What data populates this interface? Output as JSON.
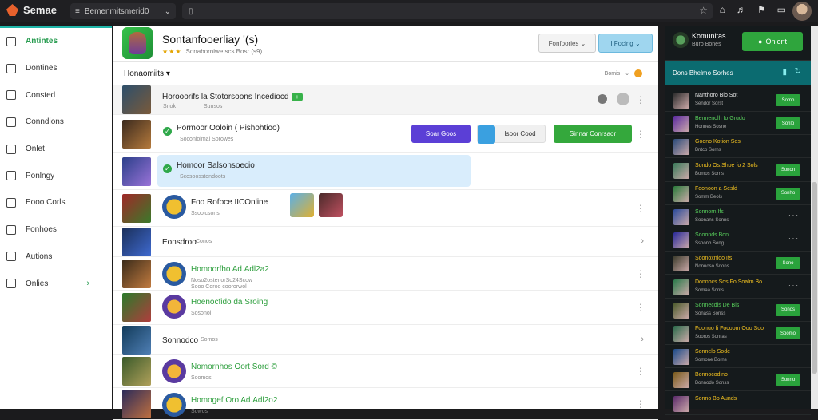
{
  "topbar": {
    "brand": "Semae",
    "address": "Bemenmitsmerid0",
    "url_icon": "≡",
    "star": "☆",
    "icons": [
      "house-icon",
      "bell-icon",
      "notify-icon",
      "window-icon",
      "tab-icon"
    ]
  },
  "sidebar": {
    "items": [
      {
        "label": "Antintes",
        "active": true
      },
      {
        "label": "Dontines"
      },
      {
        "label": "Consted"
      },
      {
        "label": "Conndions"
      },
      {
        "label": "Onlet"
      },
      {
        "label": "Ponlngy"
      },
      {
        "label": "Eooo Corls"
      },
      {
        "label": "Fonhoes"
      },
      {
        "label": "Autions"
      },
      {
        "label": "Onlies"
      }
    ]
  },
  "header": {
    "title": "Sontanfooerliay '(s)",
    "rating_text": "Sonaborniwe scs Bosr (s9)",
    "select": "Fonfoories",
    "button": "I Focing"
  },
  "sort": {
    "label": "Honaomiits",
    "right_label": "Bomis"
  },
  "rows": [
    {
      "title": "Horooorifs la Stotorsoons Incediocd",
      "badge": "+",
      "sub1": "Snok",
      "sub2": "Sunsos"
    },
    {
      "title": "Pormoor Ooloin ( Pishohtioo)",
      "sub": "Soconlolmal Sorowes",
      "btn1": "Soar Goos",
      "btn2": "Isoor Cood",
      "btn3": "Sinnar Conrsaor"
    },
    {
      "title": "Homoor Salsohsoecio",
      "sub": "Scosoosstondoots"
    },
    {
      "title": "Foo Rofoce IICOnline",
      "sub": "Ssooicsons"
    },
    {
      "title": "Eonsdroo",
      "sub": "Conos"
    },
    {
      "title": "Homoorfho Ad.Adl2a2",
      "sub": "Noso2ostenorSo24Scow",
      "sub2": "Sooo Coroo coororwol"
    },
    {
      "title": "Hoenocfido da Sroing",
      "sub": "Sosonoi"
    },
    {
      "title": "Sonnodco",
      "sub": "Somos"
    },
    {
      "title": "Nomornhos Oort Sord ©",
      "sub": "Soomos"
    },
    {
      "title": "Homogef Oro Ad.Adl2o2",
      "sub": "Sowos"
    }
  ],
  "right": {
    "title": "Komunitas",
    "subtitle": "Buro Bones",
    "online_button": "Onlent",
    "tab": "Dons Bhelmo Sorhes",
    "items": [
      {
        "name": "Nanthoro Bio Sot",
        "sub": "Sendor Sorst",
        "btn": "Somo",
        "style": ""
      },
      {
        "name": "Bennenolh Io Grudo",
        "sub": "Honnes Sosne",
        "btn": "Sonlo",
        "style": "g"
      },
      {
        "name": "Goono Kotion Sos",
        "sub": "Bntco Sorns",
        "btn": "",
        "style": "y"
      },
      {
        "name": "Sondo Os.Shoe fo 2 Sols",
        "sub": "Bomos Sorns",
        "btn": "Sonon",
        "style": "y"
      },
      {
        "name": "Foonoon a Sesld",
        "sub": "Somm Beols",
        "btn": "Sonho",
        "style": "y"
      },
      {
        "name": "Sonnorn Ifs",
        "sub": "Soonans Sonns",
        "btn": "",
        "style": "g"
      },
      {
        "name": "Sooonds Bon",
        "sub": "Ssoonb Song",
        "btn": "",
        "style": "g"
      },
      {
        "name": "Soonoxnioo Ifs",
        "sub": "Nonnoso Sdons",
        "btn": "Sono",
        "style": "y"
      },
      {
        "name": "Donnocs Sos.Fo Soalm Bo",
        "sub": "Somaa Sonts",
        "btn": "",
        "style": "y"
      },
      {
        "name": "Sonnecdis De Bis",
        "sub": "Sonass Sonss",
        "btn": "Sonos",
        "style": "g"
      },
      {
        "name": "Foonuo fi Focoom Ooo Soo",
        "sub": "Sooros Sonras",
        "btn": "Soomo",
        "style": "y"
      },
      {
        "name": "Sonnelo Sode",
        "sub": "Somone Borns",
        "btn": "",
        "style": "y"
      },
      {
        "name": "Bonnocodino",
        "sub": "Bonnodo Sonss",
        "btn": "Sonno",
        "style": "y"
      },
      {
        "name": "Sonno Bo Aunds",
        "sub": "",
        "btn": "",
        "style": "y"
      }
    ]
  }
}
